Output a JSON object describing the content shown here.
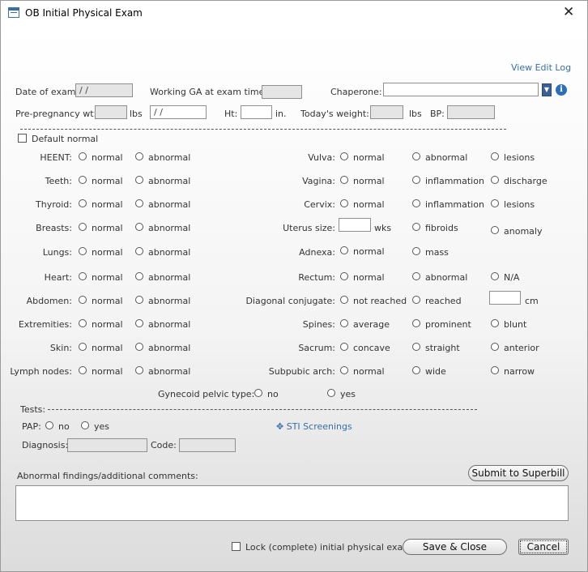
{
  "window": {
    "title": "OB Initial Physical Exam",
    "close": "✕"
  },
  "header": {
    "view_edit_log": "View Edit Log",
    "date_label": "Date of exam:",
    "date_value": "/ /",
    "ga_label": "Working GA at exam time:",
    "chaperone_label": "Chaperone:",
    "prepreg_label": "Pre-pregnancy wt:",
    "lbs1": "lbs",
    "prepreg_date": "/ /",
    "ht_label": "Ht:",
    "in": "in.",
    "todays_label": "Today's weight:",
    "lbs2": "lbs",
    "bp_label": "BP:"
  },
  "default_normal": "Default normal",
  "left_rows": [
    {
      "label": "HEENT:",
      "o1": "normal",
      "o2": "abnormal"
    },
    {
      "label": "Teeth:",
      "o1": "normal",
      "o2": "abnormal"
    },
    {
      "label": "Thyroid:",
      "o1": "normal",
      "o2": "abnormal"
    },
    {
      "label": "Breasts:",
      "o1": "normal",
      "o2": "abnormal"
    },
    {
      "label": "Lungs:",
      "o1": "normal",
      "o2": "abnormal"
    },
    {
      "label": "Heart:",
      "o1": "normal",
      "o2": "abnormal"
    },
    {
      "label": "Abdomen:",
      "o1": "normal",
      "o2": "abnormal"
    },
    {
      "label": "Extremities:",
      "o1": "normal",
      "o2": "abnormal"
    },
    {
      "label": "Skin:",
      "o1": "normal",
      "o2": "abnormal"
    },
    {
      "label": "Lymph nodes:",
      "o1": "normal",
      "o2": "abnormal"
    }
  ],
  "right_rows": [
    {
      "label": "Vulva:",
      "o1": "normal",
      "o2": "abnormal",
      "o3": "lesions"
    },
    {
      "label": "Vagina:",
      "o1": "normal",
      "o2": "inflammation",
      "o3": "discharge"
    },
    {
      "label": "Cervix:",
      "o1": "normal",
      "o2": "inflammation",
      "o3": "lesions"
    },
    {
      "label": "Uterus size:",
      "unit": "wks",
      "o2": "fibroids",
      "o3": "anomaly"
    },
    {
      "label": "Adnexa:",
      "o1": "normal",
      "o2": "mass"
    },
    {
      "label": "Rectum:",
      "o1": "normal",
      "o2": "abnormal",
      "o3": "N/A"
    },
    {
      "label": "Diagonal conjugate:",
      "o1": "not reached",
      "o2": "reached",
      "unit": "cm"
    },
    {
      "label": "Spines:",
      "o1": "average",
      "o2": "prominent",
      "o3": "blunt"
    },
    {
      "label": "Sacrum:",
      "o1": "concave",
      "o2": "straight",
      "o3": "anterior"
    },
    {
      "label": "Subpubic arch:",
      "o1": "normal",
      "o2": "wide",
      "o3": "narrow"
    }
  ],
  "gynecoid": {
    "label": "Gynecoid pelvic type:",
    "o1": "no",
    "o2": "yes"
  },
  "tests": {
    "label": "Tests:",
    "pap_label": "PAP:",
    "pap_no": "no",
    "pap_yes": "yes",
    "sti_icon": "✥",
    "sti": "STI Screenings",
    "diagnosis_label": "Diagnosis:",
    "code_label": "Code:"
  },
  "comments_label": "Abnormal findings/additional comments:",
  "submit_superbill": "Submit to Superbill",
  "lock_label": "Lock (complete) initial physical exam",
  "save_close": "Save & Close",
  "cancel": "Cancel",
  "colors": {
    "link": "#3a6ea5",
    "info": "#2c6fb8",
    "dropdown": "#3c5f99"
  }
}
